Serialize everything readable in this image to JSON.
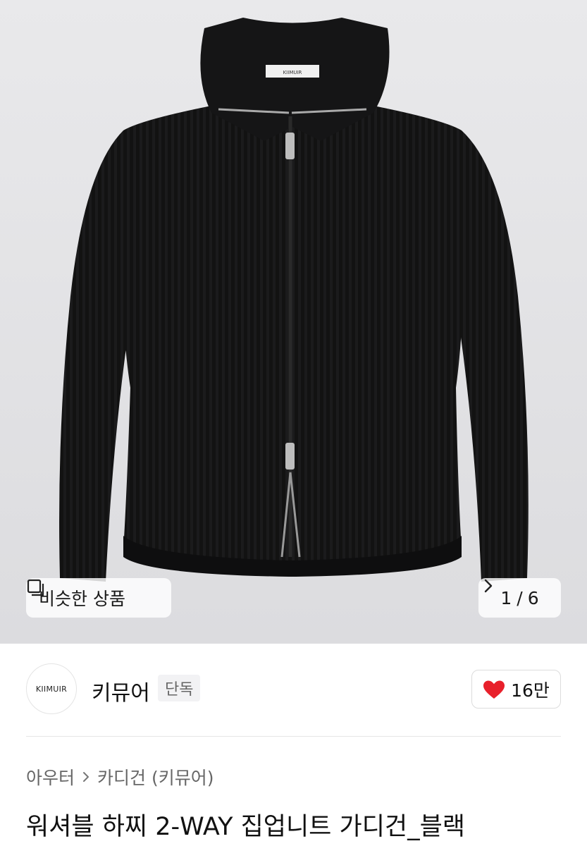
{
  "hero": {
    "image_label": "KIIMUIR",
    "similar_button_label": "비슷한 상품",
    "pager": {
      "current": "1",
      "separator": "/",
      "total": "6"
    }
  },
  "brand": {
    "logo_text": "KIIMUIR",
    "name": "키뮤어",
    "badge": "단독",
    "likes": "16만",
    "heart_color": "#e8202b"
  },
  "breadcrumb": {
    "items": [
      "아우터",
      "카디건 (키뮤어)"
    ]
  },
  "product": {
    "title": "워셔블 하찌 2-WAY 집업니트 가디건_블랙"
  },
  "icons": {
    "similar": "similar-products-icon",
    "pager_next": "chevron-right-icon",
    "like": "heart-icon",
    "breadcrumb_sep": "chevron-right-icon"
  }
}
